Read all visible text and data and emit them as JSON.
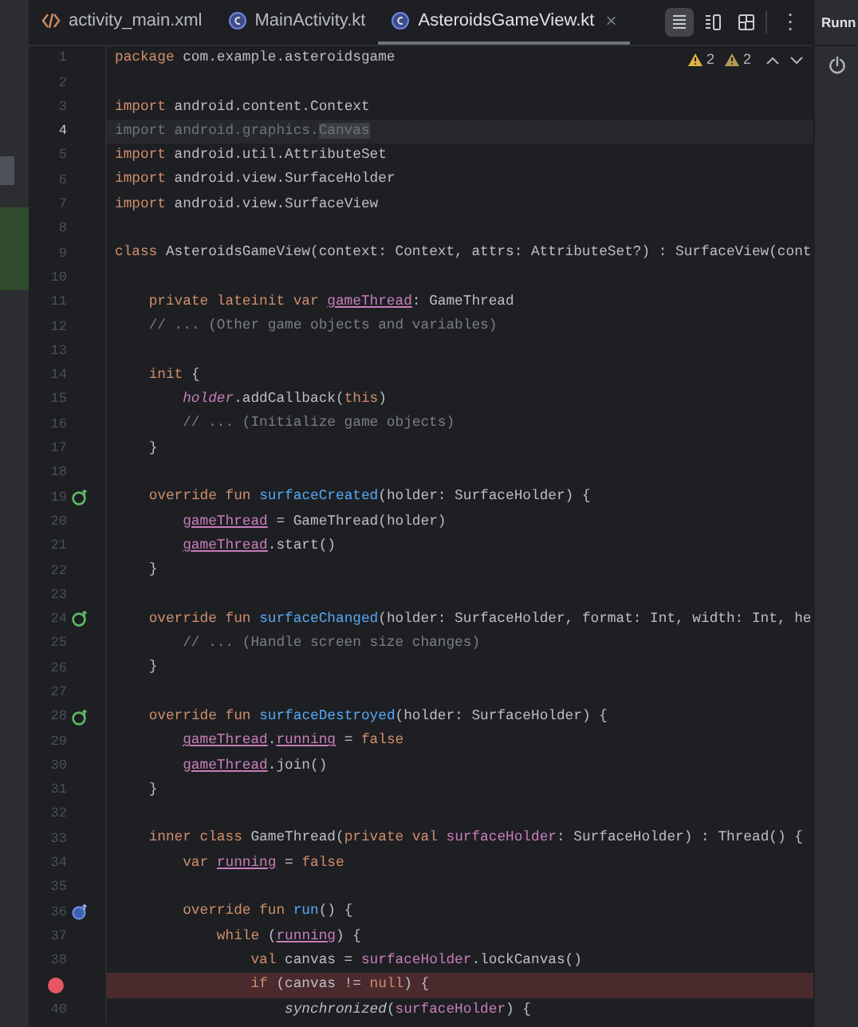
{
  "tabs": [
    {
      "label": "activity_main.xml",
      "kind": "xml",
      "selected": false
    },
    {
      "label": "MainActivity.kt",
      "kind": "kotlin",
      "selected": false
    },
    {
      "label": "AsteroidsGameView.kt",
      "kind": "kotlin",
      "selected": true,
      "close": "×"
    }
  ],
  "view_modes": [
    {
      "kind": "code",
      "selected": true
    },
    {
      "kind": "split",
      "selected": false
    },
    {
      "kind": "design",
      "selected": false
    }
  ],
  "more_glyph": "⋮",
  "side_panel": {
    "title": "Runn"
  },
  "inspections": [
    {
      "kind": "warning",
      "count": "2"
    },
    {
      "kind": "weak-warning",
      "count": "2"
    }
  ],
  "lines": [
    {
      "number": "1",
      "current": false,
      "tokens": [
        {
          "kind": "keyword",
          "text": "package"
        },
        {
          "kind": "plain",
          "text": " com.example.asteroidsgame"
        }
      ]
    },
    {
      "number": "2",
      "current": false
    },
    {
      "number": "3",
      "current": false,
      "tokens": [
        {
          "kind": "keyword",
          "text": "import"
        },
        {
          "kind": "plain",
          "text": " android.content.Context"
        }
      ]
    },
    {
      "number": "4",
      "current": true,
      "tokens": [
        {
          "kind": "unused",
          "text": "import android.graphics."
        },
        {
          "kind": "unused-match",
          "text": "Canvas"
        }
      ]
    },
    {
      "number": "5",
      "current": false,
      "tokens": [
        {
          "kind": "keyword",
          "text": "import"
        },
        {
          "kind": "plain",
          "text": " android.util.AttributeSet"
        }
      ]
    },
    {
      "number": "6",
      "current": false,
      "tokens": [
        {
          "kind": "keyword",
          "text": "import"
        },
        {
          "kind": "plain",
          "text": " android.view.SurfaceHolder"
        }
      ]
    },
    {
      "number": "7",
      "current": false,
      "tokens": [
        {
          "kind": "keyword",
          "text": "import"
        },
        {
          "kind": "plain",
          "text": " android.view.SurfaceView"
        }
      ]
    },
    {
      "number": "8",
      "current": false
    },
    {
      "number": "9",
      "current": false,
      "tokens": [
        {
          "kind": "keyword",
          "text": "class"
        },
        {
          "kind": "plain",
          "text": " AsteroidsGameView(context: Context, attrs: AttributeSet?) : SurfaceView(cont"
        }
      ]
    },
    {
      "number": "10",
      "current": false
    },
    {
      "number": "11",
      "current": false,
      "tokens": [
        {
          "kind": "keyword",
          "text": "    private lateinit var "
        },
        {
          "kind": "property-mutable",
          "text": "gameThread"
        },
        {
          "kind": "plain",
          "text": ": GameThread"
        }
      ]
    },
    {
      "number": "12",
      "current": false,
      "tokens": [
        {
          "kind": "comment",
          "text": "    // ... (Other game objects and variables)"
        }
      ]
    },
    {
      "number": "13",
      "current": false
    },
    {
      "number": "14",
      "current": false,
      "tokens": [
        {
          "kind": "keyword",
          "text": "    init"
        },
        {
          "kind": "plain",
          "text": " {"
        }
      ]
    },
    {
      "number": "15",
      "current": false,
      "tokens": [
        {
          "kind": "implicit",
          "text": "        holder"
        },
        {
          "kind": "plain",
          "text": ".addCallback("
        },
        {
          "kind": "keyword",
          "text": "this"
        },
        {
          "kind": "plain",
          "text": ")"
        }
      ]
    },
    {
      "number": "16",
      "current": false,
      "tokens": [
        {
          "kind": "comment",
          "text": "        // ... (Initialize game objects)"
        }
      ]
    },
    {
      "number": "17",
      "current": false,
      "tokens": [
        {
          "kind": "plain",
          "text": "    }"
        }
      ]
    },
    {
      "number": "18",
      "current": false
    },
    {
      "number": "19",
      "current": false,
      "gutter_icon": {
        "kind": "override"
      },
      "tokens": [
        {
          "kind": "keyword",
          "text": "    override fun "
        },
        {
          "kind": "function",
          "text": "surfaceCreated"
        },
        {
          "kind": "plain",
          "text": "(holder: SurfaceHolder) {"
        }
      ]
    },
    {
      "number": "20",
      "current": false,
      "tokens": [
        {
          "kind": "property-mutable",
          "text": "        gameThread"
        },
        {
          "kind": "plain",
          "text": " = GameThread(holder)"
        }
      ]
    },
    {
      "number": "21",
      "current": false,
      "tokens": [
        {
          "kind": "property-mutable",
          "text": "        gameThread"
        },
        {
          "kind": "plain",
          "text": ".start()"
        }
      ]
    },
    {
      "number": "22",
      "current": false,
      "tokens": [
        {
          "kind": "plain",
          "text": "    }"
        }
      ]
    },
    {
      "number": "23",
      "current": false
    },
    {
      "number": "24",
      "current": false,
      "gutter_icon": {
        "kind": "override"
      },
      "tokens": [
        {
          "kind": "keyword",
          "text": "    override fun "
        },
        {
          "kind": "function",
          "text": "surfaceChanged"
        },
        {
          "kind": "plain",
          "text": "(holder: SurfaceHolder, format: Int, width: Int, he"
        }
      ]
    },
    {
      "number": "25",
      "current": false,
      "tokens": [
        {
          "kind": "comment",
          "text": "        // ... (Handle screen size changes)"
        }
      ]
    },
    {
      "number": "26",
      "current": false,
      "tokens": [
        {
          "kind": "plain",
          "text": "    }"
        }
      ]
    },
    {
      "number": "27",
      "current": false
    },
    {
      "number": "28",
      "current": false,
      "gutter_icon": {
        "kind": "override"
      },
      "tokens": [
        {
          "kind": "keyword",
          "text": "    override fun "
        },
        {
          "kind": "function",
          "text": "surfaceDestroyed"
        },
        {
          "kind": "plain",
          "text": "(holder: SurfaceHolder) {"
        }
      ]
    },
    {
      "number": "29",
      "current": false,
      "tokens": [
        {
          "kind": "property-mutable",
          "text": "        gameThread"
        },
        {
          "kind": "plain",
          "text": "."
        },
        {
          "kind": "property-mutable",
          "text": "running"
        },
        {
          "kind": "plain",
          "text": " = "
        },
        {
          "kind": "keyword",
          "text": "false"
        }
      ]
    },
    {
      "number": "30",
      "current": false,
      "tokens": [
        {
          "kind": "property-mutable",
          "text": "        gameThread"
        },
        {
          "kind": "plain",
          "text": ".join()"
        }
      ]
    },
    {
      "number": "31",
      "current": false,
      "tokens": [
        {
          "kind": "plain",
          "text": "    }"
        }
      ]
    },
    {
      "number": "32",
      "current": false
    },
    {
      "number": "33",
      "current": false,
      "tokens": [
        {
          "kind": "keyword",
          "text": "    inner class "
        },
        {
          "kind": "plain",
          "text": "GameThread("
        },
        {
          "kind": "keyword",
          "text": "private val "
        },
        {
          "kind": "property",
          "text": "surfaceHolder"
        },
        {
          "kind": "plain",
          "text": ": SurfaceHolder) : Thread() {"
        }
      ]
    },
    {
      "number": "34",
      "current": false,
      "tokens": [
        {
          "kind": "keyword",
          "text": "        var "
        },
        {
          "kind": "property-mutable",
          "text": "running"
        },
        {
          "kind": "plain",
          "text": " = "
        },
        {
          "kind": "keyword",
          "text": "false"
        }
      ]
    },
    {
      "number": "35",
      "current": false
    },
    {
      "number": "36",
      "current": false,
      "gutter_icon": {
        "kind": "implement"
      },
      "tokens": [
        {
          "kind": "keyword",
          "text": "        override fun "
        },
        {
          "kind": "function",
          "text": "run"
        },
        {
          "kind": "plain",
          "text": "() {"
        }
      ]
    },
    {
      "number": "37",
      "current": false,
      "tokens": [
        {
          "kind": "keyword",
          "text": "            while "
        },
        {
          "kind": "plain",
          "text": "("
        },
        {
          "kind": "property-mutable",
          "text": "running"
        },
        {
          "kind": "plain",
          "text": ") {"
        }
      ]
    },
    {
      "number": "38",
      "current": false,
      "tokens": [
        {
          "kind": "keyword",
          "text": "                val "
        },
        {
          "kind": "plain",
          "text": "canvas = "
        },
        {
          "kind": "property",
          "text": "surfaceHolder"
        },
        {
          "kind": "plain",
          "text": ".lockCanvas()"
        }
      ]
    },
    {
      "current": false,
      "gutter_icon": {
        "kind": "breakpoint"
      },
      "tokens": [
        {
          "kind": "keyword",
          "text": "                if "
        },
        {
          "kind": "plain",
          "text": "(canvas != "
        },
        {
          "kind": "keyword",
          "text": "null"
        },
        {
          "kind": "plain",
          "text": ") {"
        }
      ]
    },
    {
      "number": "40",
      "current": false,
      "tokens": [
        {
          "kind": "call-italic",
          "text": "                    synchronized"
        },
        {
          "kind": "plain",
          "text": "("
        },
        {
          "kind": "property",
          "text": "surfaceHolder"
        },
        {
          "kind": "plain",
          "text": ") {"
        }
      ]
    }
  ]
}
